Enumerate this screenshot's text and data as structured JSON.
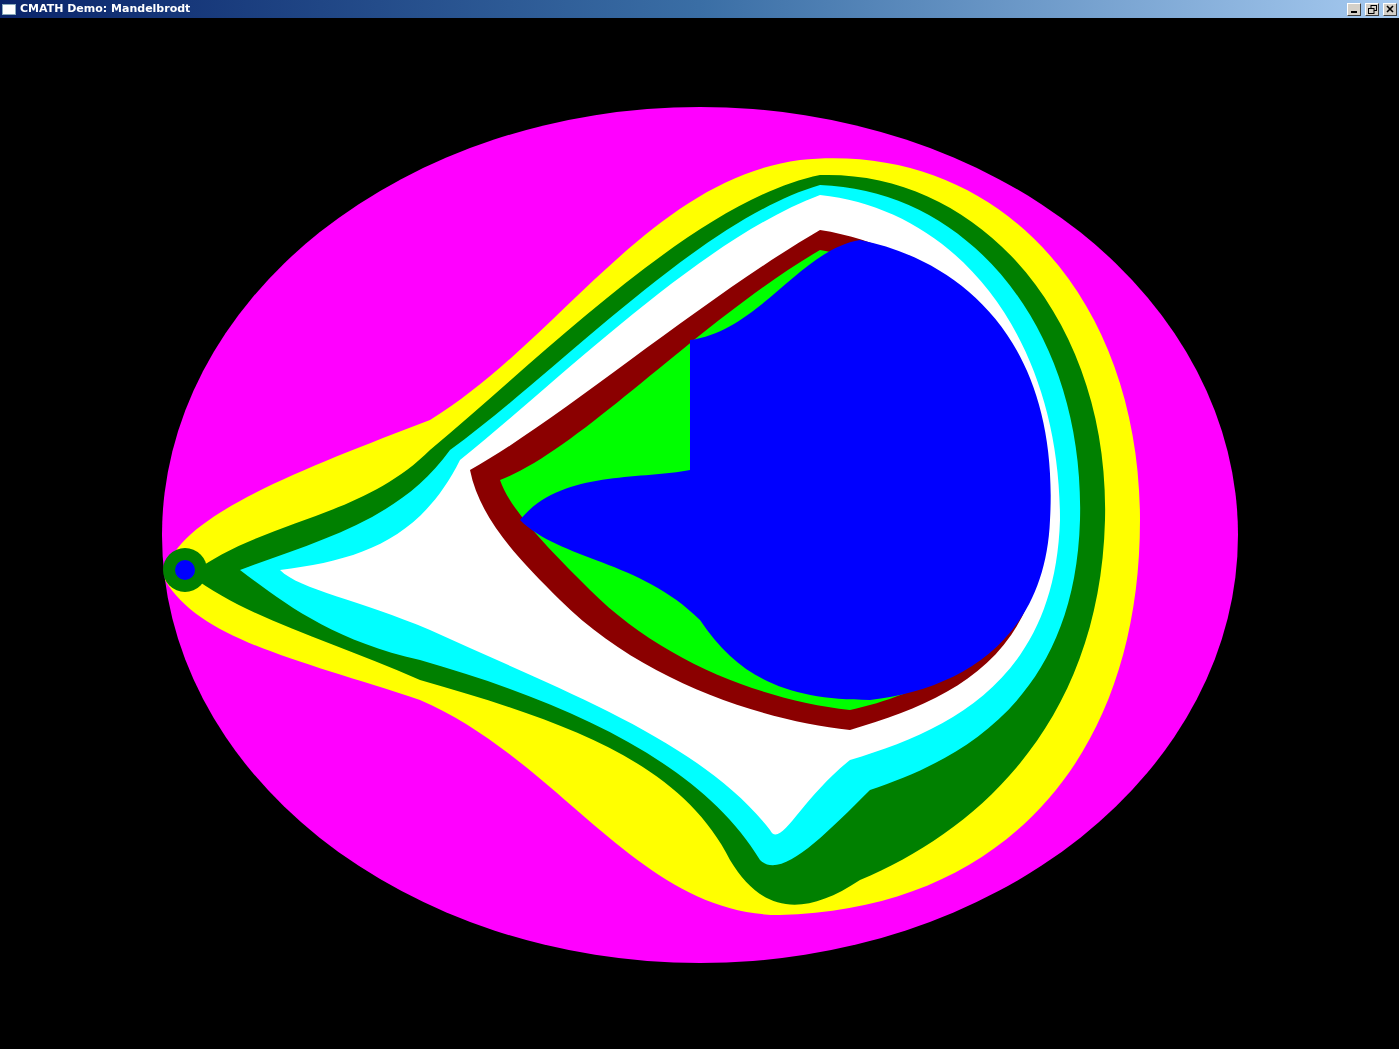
{
  "window": {
    "title": "CMATH Demo: Mandelbrodt"
  }
}
